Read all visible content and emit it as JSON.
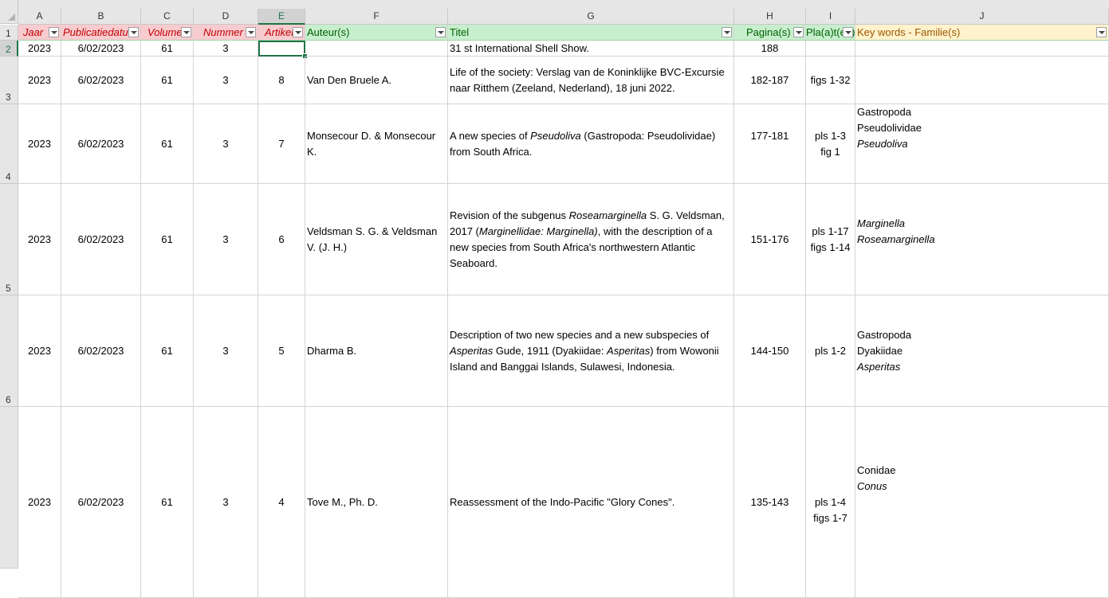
{
  "columns": [
    "A",
    "B",
    "C",
    "D",
    "E",
    "F",
    "G",
    "H",
    "I",
    "J"
  ],
  "rows": [
    "1",
    "2",
    "3",
    "4",
    "5",
    "6"
  ],
  "headers": {
    "a": "Jaar",
    "b": "Publicatiedatum",
    "c": "Volume",
    "d": "Nummer",
    "e": "Artikel",
    "f": "Auteur(s)",
    "g": "Titel",
    "h": "Pagina(s)",
    "i": "Pla(a)t(en)",
    "j": "Key words - Familie(s)"
  },
  "data": [
    {
      "jaar": "2023",
      "datum": "6/02/2023",
      "volume": "61",
      "nummer": "3",
      "artikel": "",
      "auteur": "",
      "titel": "31 st International Shell Show.",
      "pagina": "188",
      "platen": "",
      "kw": []
    },
    {
      "jaar": "2023",
      "datum": "6/02/2023",
      "volume": "61",
      "nummer": "3",
      "artikel": "8",
      "auteur": "Van Den Bruele A.",
      "titel": "Life of the society: Verslag van de Koninklijke BVC-Excursie naar Ritthem (Zeeland, Nederland), 18 juni 2022.",
      "pagina": "182-187",
      "platen": "figs 1-32",
      "kw": []
    },
    {
      "jaar": "2023",
      "datum": "6/02/2023",
      "volume": "61",
      "nummer": "3",
      "artikel": "7",
      "auteur": "Monsecour D. & Monsecour K.",
      "titel_parts": [
        "A new species of ",
        "Pseudoliva",
        " (Gastropoda: Pseudolividae) from South Africa."
      ],
      "pagina": "177-181",
      "platen": "pls 1-3 fig 1",
      "kw": [
        "Gastropoda",
        "Pseudolividae",
        "Pseudoliva"
      ]
    },
    {
      "jaar": "2023",
      "datum": "6/02/2023",
      "volume": "61",
      "nummer": "3",
      "artikel": "6",
      "auteur": "Veldsman S. G. & Veldsman V. (J. H.)",
      "titel_parts": [
        "Revision of the subgenus ",
        "Roseamarginella",
        " S. G. Veldsman, 2017 (",
        "Marginellidae: Marginella)",
        ", with the description of a new species from South Africa's northwestern Atlantic Seaboard."
      ],
      "pagina": "151-176",
      "platen": "pls 1-17 figs 1-14",
      "kw": [
        "Marginella",
        "Roseamarginella"
      ]
    },
    {
      "jaar": "2023",
      "datum": "6/02/2023",
      "volume": "61",
      "nummer": "3",
      "artikel": "5",
      "auteur": "Dharma B.",
      "titel_parts": [
        "Description of two new species and a new subspecies of ",
        "Asperitas",
        " Gude, 1911 (Dyakiidae: ",
        "Asperitas",
        ") from Wowonii Island and Banggai Islands, Sulawesi, Indonesia."
      ],
      "pagina": "144-150",
      "platen": "pls 1-2",
      "kw": [
        "Gastropoda",
        "Dyakiidae",
        "Asperitas"
      ]
    },
    {
      "jaar": "2023",
      "datum": "6/02/2023",
      "volume": "61",
      "nummer": "3",
      "artikel": "4",
      "auteur": "Tove M., Ph. D.",
      "titel": "Reassessment of the Indo-Pacific \"Glory Cones\".",
      "pagina": "135-143",
      "platen": "pls 1-4 figs 1-7",
      "kw": [
        "Conidae",
        "Conus"
      ]
    }
  ],
  "colors": {
    "accent": "#217346",
    "header_red": "#f8cbcf",
    "header_green": "#c7efce",
    "header_yellow": "#fff2cc"
  },
  "active_cell": "E2"
}
